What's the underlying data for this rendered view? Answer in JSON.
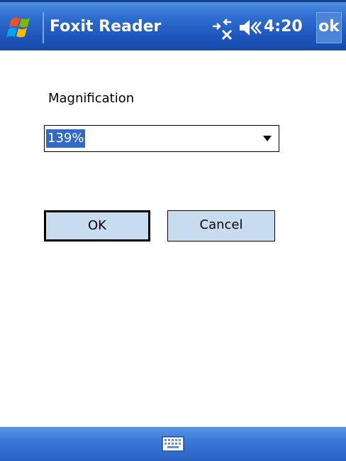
{
  "titlebar": {
    "app_title": "Foxit Reader",
    "clock": "4:20",
    "ok_label": "ok",
    "icons": [
      "windows-start-icon",
      "connectivity-icon",
      "volume-icon"
    ],
    "color": "#2f6fd0"
  },
  "dialog": {
    "magnification_label": "Magnification",
    "magnification_value": "139%",
    "ok_button": "OK",
    "cancel_button": "Cancel"
  },
  "bottombar": {
    "icons": [
      "keyboard-icon"
    ]
  },
  "colors": {
    "button_fill": "#c8dcf0",
    "selection": "#3169c6"
  }
}
